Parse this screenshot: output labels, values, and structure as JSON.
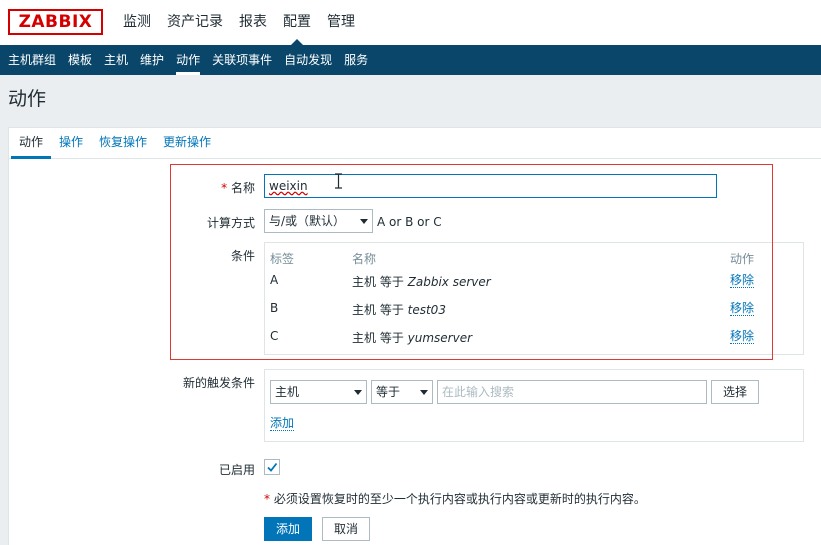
{
  "brand": {
    "logo_text": "ZABBIX",
    "logo_color": "#d40000"
  },
  "main_menu": [
    {
      "label": "监测",
      "active": false
    },
    {
      "label": "资产记录",
      "active": false
    },
    {
      "label": "报表",
      "active": false
    },
    {
      "label": "配置",
      "active": true
    },
    {
      "label": "管理",
      "active": false
    }
  ],
  "sub_menu": [
    {
      "label": "主机群组",
      "active": false
    },
    {
      "label": "模板",
      "active": false
    },
    {
      "label": "主机",
      "active": false
    },
    {
      "label": "维护",
      "active": false
    },
    {
      "label": "动作",
      "active": true
    },
    {
      "label": "关联项事件",
      "active": false
    },
    {
      "label": "自动发现",
      "active": false
    },
    {
      "label": "服务",
      "active": false
    }
  ],
  "page_title": "动作",
  "tabs": [
    {
      "label": "动作",
      "active": true
    },
    {
      "label": "操作",
      "active": false
    },
    {
      "label": "恢复操作",
      "active": false
    },
    {
      "label": "更新操作",
      "active": false
    }
  ],
  "form": {
    "name_label": "名称",
    "required_mark": "*",
    "name_value": "weixin",
    "calc_label": "计算方式",
    "calc_value": "与/或（默认）",
    "calc_expression": "A or B or C",
    "conditions_label": "条件",
    "conditions_headers": {
      "tag": "标签",
      "name": "名称",
      "action": "动作"
    },
    "conditions": [
      {
        "tag": "A",
        "prefix": "主机 等于 ",
        "value": "Zabbix server",
        "action": "移除"
      },
      {
        "tag": "B",
        "prefix": "主机 等于 ",
        "value": "test03",
        "action": "移除"
      },
      {
        "tag": "C",
        "prefix": "主机 等于 ",
        "value": "yumserver",
        "action": "移除"
      }
    ],
    "new_condition_label": "新的触发条件",
    "new_condition_type": "主机",
    "new_condition_operator": "等于",
    "new_condition_placeholder": "在此输入搜索",
    "select_button": "选择",
    "add_link": "添加",
    "enabled_label": "已启用",
    "enabled_checked": true,
    "note": "必须设置恢复时的至少一个执行内容或执行内容或更新时的执行内容。",
    "add_button": "添加",
    "cancel_button": "取消"
  },
  "colors": {
    "nav_bg": "#0a466a",
    "link": "#0275b8",
    "highlight_frame": "#e33734",
    "required": "#d40000"
  }
}
